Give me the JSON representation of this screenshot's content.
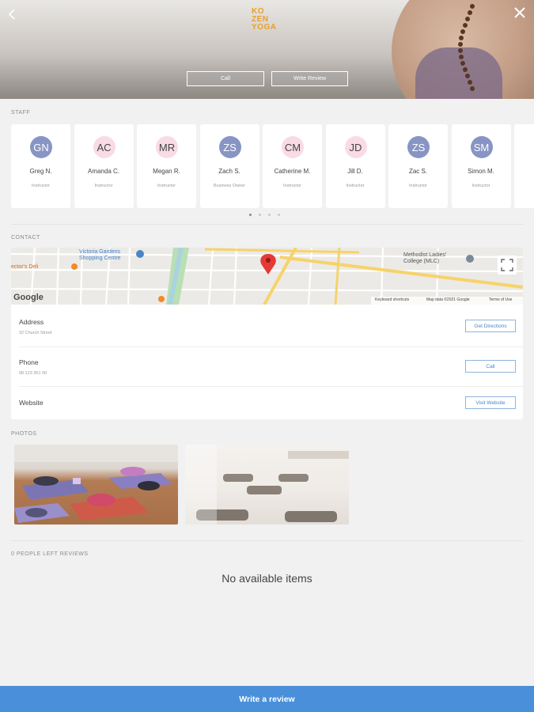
{
  "header": {
    "logo_lines": [
      "KO",
      "ZEN",
      "YOGA"
    ],
    "call_label": "Call",
    "write_review_label": "Write Review"
  },
  "staff": {
    "section_label": "STAFF",
    "members": [
      {
        "initials": "GN",
        "name": "Greg N.",
        "role": "Instructor",
        "avatar_style": "blue"
      },
      {
        "initials": "AC",
        "name": "Amanda C.",
        "role": "Instructor",
        "avatar_style": "pink"
      },
      {
        "initials": "MR",
        "name": "Megan R.",
        "role": "Instructor",
        "avatar_style": "pink"
      },
      {
        "initials": "ZS",
        "name": "Zach S.",
        "role": "Business Owner",
        "avatar_style": "blue"
      },
      {
        "initials": "CM",
        "name": "Catherine M.",
        "role": "Instructor",
        "avatar_style": "pink"
      },
      {
        "initials": "JD",
        "name": "Jill D.",
        "role": "Instructor",
        "avatar_style": "pink"
      },
      {
        "initials": "ZS",
        "name": "Zac S.",
        "role": "Instructor",
        "avatar_style": "blue"
      },
      {
        "initials": "SM",
        "name": "Simon M.",
        "role": "Instructor",
        "avatar_style": "blue"
      }
    ],
    "page_count": 4,
    "active_page": 1
  },
  "contact": {
    "section_label": "CONTACT",
    "map": {
      "labels": {
        "shopping": "Victoria Gardens\nShopping Centre",
        "deli": "ector's Deli",
        "college": "Methodist Ladies'\nCollege (MLC)",
        "google": "Google",
        "keyboard": "Keyboard shortcuts",
        "mapdata": "Map data ©2021 Google",
        "terms": "Terms of Use"
      }
    },
    "address": {
      "title": "Address",
      "value": "32 Church Street",
      "button": "Get Directions"
    },
    "phone": {
      "title": "Phone",
      "value": "08 123 951 00",
      "button": "Call"
    },
    "website": {
      "title": "Website",
      "button": "Visit Website"
    }
  },
  "photos": {
    "section_label": "PHOTOS"
  },
  "reviews": {
    "section_label": "0 PEOPLE LEFT REVIEWS",
    "empty_text": "No available items"
  },
  "footer": {
    "write_review_label": "Write a review"
  },
  "colors": {
    "accent": "#4a8fd9",
    "avatar_blue": "#8895c4",
    "avatar_pink": "#f9dbe5",
    "logo": "#e8a02a"
  }
}
